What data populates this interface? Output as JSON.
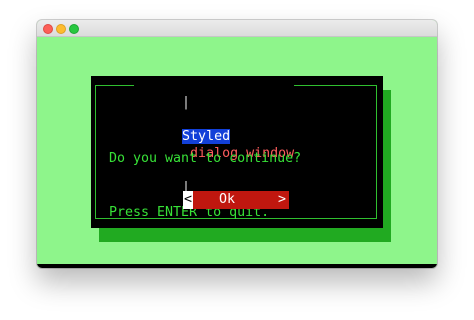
{
  "dialog": {
    "title_left_bar": "|",
    "title_highlight": "Styled",
    "title_rest": " dialog window",
    "title_right_bar": "|",
    "message_line1": "Do you want to continue?",
    "message_line2": "Press ENTER to quit.",
    "button_left": "<",
    "button_label": "Ok",
    "button_right": ">"
  },
  "colors": {
    "terminal_background": "#8ef58b",
    "dialog_background": "#000000",
    "dialog_shadow": "#21aa21",
    "title_highlight": "#1240d8",
    "title_text": "#ff5d5d",
    "message_text": "#37e137",
    "button_background": "#c0170f"
  }
}
